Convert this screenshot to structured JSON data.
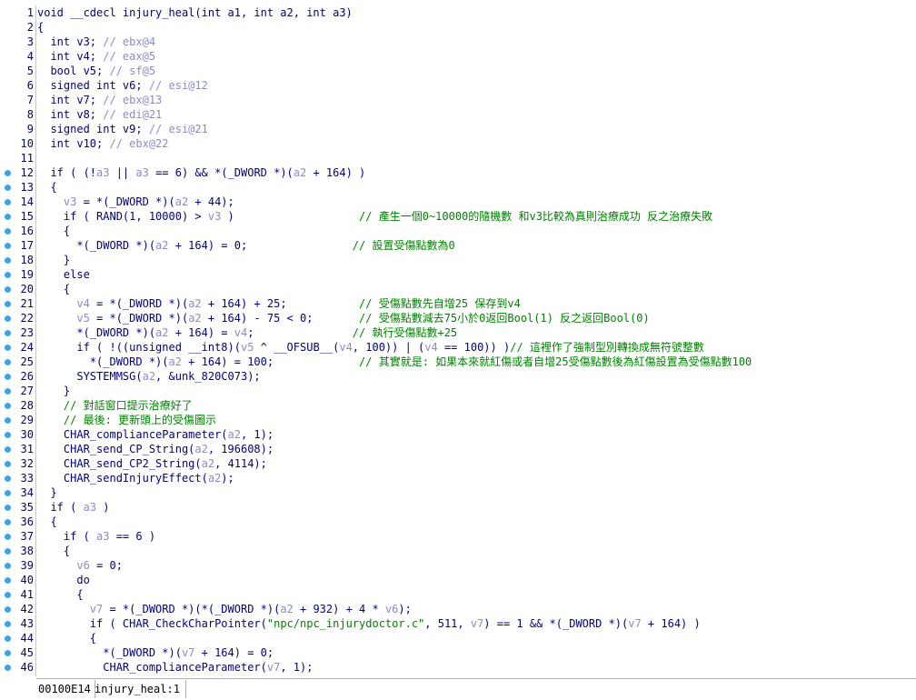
{
  "editor": {
    "lines": [
      {
        "n": "1",
        "bp": false,
        "segs": [
          [
            "t",
            "void __cdecl injury_heal(int a1, int a2, int a3)"
          ]
        ]
      },
      {
        "n": "2",
        "bp": false,
        "segs": [
          [
            "t",
            "{"
          ]
        ]
      },
      {
        "n": "3",
        "bp": false,
        "segs": [
          [
            "t",
            "  int v3; "
          ],
          [
            "v",
            "// ebx@4"
          ]
        ]
      },
      {
        "n": "4",
        "bp": false,
        "segs": [
          [
            "t",
            "  int v4; "
          ],
          [
            "v",
            "// eax@5"
          ]
        ]
      },
      {
        "n": "5",
        "bp": false,
        "segs": [
          [
            "t",
            "  bool v5; "
          ],
          [
            "v",
            "// sf@5"
          ]
        ]
      },
      {
        "n": "6",
        "bp": false,
        "segs": [
          [
            "t",
            "  signed int v6; "
          ],
          [
            "v",
            "// esi@12"
          ]
        ]
      },
      {
        "n": "7",
        "bp": false,
        "segs": [
          [
            "t",
            "  int v7; "
          ],
          [
            "v",
            "// ebx@13"
          ]
        ]
      },
      {
        "n": "8",
        "bp": false,
        "segs": [
          [
            "t",
            "  int v8; "
          ],
          [
            "v",
            "// edi@21"
          ]
        ]
      },
      {
        "n": "9",
        "bp": false,
        "segs": [
          [
            "t",
            "  signed int v9; "
          ],
          [
            "v",
            "// esi@21"
          ]
        ]
      },
      {
        "n": "10",
        "bp": false,
        "segs": [
          [
            "t",
            "  int v10; "
          ],
          [
            "v",
            "// ebx@22"
          ]
        ]
      },
      {
        "n": "11",
        "bp": false,
        "segs": [
          [
            "t",
            ""
          ]
        ]
      },
      {
        "n": "12",
        "bp": true,
        "segs": [
          [
            "t",
            "  if ( (!"
          ],
          [
            "v",
            "a3"
          ],
          [
            "t",
            " || "
          ],
          [
            "v",
            "a3"
          ],
          [
            "t",
            " == 6) && *(_DWORD *)("
          ],
          [
            "v",
            "a2"
          ],
          [
            "t",
            " + 164) )"
          ]
        ]
      },
      {
        "n": "13",
        "bp": true,
        "segs": [
          [
            "t",
            "  {"
          ]
        ]
      },
      {
        "n": "14",
        "bp": true,
        "segs": [
          [
            "t",
            "    "
          ],
          [
            "v",
            "v3"
          ],
          [
            "t",
            " = *(_DWORD *)("
          ],
          [
            "v",
            "a2"
          ],
          [
            "t",
            " + 44);"
          ]
        ]
      },
      {
        "n": "15",
        "bp": true,
        "segs": [
          [
            "t",
            "    if ( RAND(1, 10000) > "
          ],
          [
            "v",
            "v3"
          ],
          [
            "t",
            " )                   "
          ],
          [
            "c",
            "// 產生一個0~10000的隨機數 和v3比較為真則治療成功 反之治療失敗"
          ]
        ]
      },
      {
        "n": "16",
        "bp": true,
        "segs": [
          [
            "t",
            "    {"
          ]
        ]
      },
      {
        "n": "17",
        "bp": true,
        "segs": [
          [
            "t",
            "      *(_DWORD *)("
          ],
          [
            "v",
            "a2"
          ],
          [
            "t",
            " + 164) = 0;                "
          ],
          [
            "c",
            "// 設置受傷點數為0"
          ]
        ]
      },
      {
        "n": "18",
        "bp": true,
        "segs": [
          [
            "t",
            "    }"
          ]
        ]
      },
      {
        "n": "19",
        "bp": true,
        "segs": [
          [
            "t",
            "    else"
          ]
        ]
      },
      {
        "n": "20",
        "bp": true,
        "segs": [
          [
            "t",
            "    {"
          ]
        ]
      },
      {
        "n": "21",
        "bp": true,
        "segs": [
          [
            "t",
            "      "
          ],
          [
            "v",
            "v4"
          ],
          [
            "t",
            " = *(_DWORD *)("
          ],
          [
            "v",
            "a2"
          ],
          [
            "t",
            " + 164) + 25;           "
          ],
          [
            "c",
            "// 受傷點數先自增25 保存到v4"
          ]
        ]
      },
      {
        "n": "22",
        "bp": true,
        "segs": [
          [
            "t",
            "      "
          ],
          [
            "v",
            "v5"
          ],
          [
            "t",
            " = *(_DWORD *)("
          ],
          [
            "v",
            "a2"
          ],
          [
            "t",
            " + 164) - 75 < 0;       "
          ],
          [
            "c",
            "// 受傷點數減去75小於0返回Bool(1) 反之返回Bool(0)"
          ]
        ]
      },
      {
        "n": "23",
        "bp": true,
        "segs": [
          [
            "t",
            "      *(_DWORD *)("
          ],
          [
            "v",
            "a2"
          ],
          [
            "t",
            " + 164) = "
          ],
          [
            "v",
            "v4"
          ],
          [
            "t",
            ";               "
          ],
          [
            "c",
            "// 執行受傷點數+25"
          ]
        ]
      },
      {
        "n": "24",
        "bp": true,
        "segs": [
          [
            "t",
            "      if ( !((unsigned __int8)("
          ],
          [
            "v",
            "v5"
          ],
          [
            "t",
            " ^ __OFSUB__("
          ],
          [
            "v",
            "v4"
          ],
          [
            "t",
            ", 100)) | ("
          ],
          [
            "v",
            "v4"
          ],
          [
            "t",
            " == 100)) )"
          ],
          [
            "c",
            "// 這裡作了強制型別轉換成無符號整數"
          ]
        ]
      },
      {
        "n": "25",
        "bp": true,
        "segs": [
          [
            "t",
            "        *(_DWORD *)("
          ],
          [
            "v",
            "a2"
          ],
          [
            "t",
            " + 164) = 100;             "
          ],
          [
            "c",
            "// 其實就是: 如果本來就紅傷或者自增25受傷點數後為紅傷設置為受傷點數100"
          ]
        ]
      },
      {
        "n": "26",
        "bp": true,
        "segs": [
          [
            "t",
            "      SYSTEMMSG("
          ],
          [
            "v",
            "a2"
          ],
          [
            "t",
            ", &unk_820C073);"
          ]
        ]
      },
      {
        "n": "27",
        "bp": true,
        "segs": [
          [
            "t",
            "    }"
          ]
        ]
      },
      {
        "n": "28",
        "bp": true,
        "segs": [
          [
            "t",
            "    "
          ],
          [
            "c",
            "// 對話窗口提示治療好了"
          ]
        ]
      },
      {
        "n": "29",
        "bp": true,
        "segs": [
          [
            "t",
            "    "
          ],
          [
            "c",
            "// 最後: 更新頭上的受傷圖示"
          ]
        ]
      },
      {
        "n": "30",
        "bp": true,
        "segs": [
          [
            "t",
            "    CHAR_complianceParameter("
          ],
          [
            "v",
            "a2"
          ],
          [
            "t",
            ", 1);"
          ]
        ]
      },
      {
        "n": "31",
        "bp": true,
        "segs": [
          [
            "t",
            "    CHAR_send_CP_String("
          ],
          [
            "v",
            "a2"
          ],
          [
            "t",
            ", 196608);"
          ]
        ]
      },
      {
        "n": "32",
        "bp": true,
        "segs": [
          [
            "t",
            "    CHAR_send_CP2_String("
          ],
          [
            "v",
            "a2"
          ],
          [
            "t",
            ", 4114);"
          ]
        ]
      },
      {
        "n": "33",
        "bp": true,
        "segs": [
          [
            "t",
            "    CHAR_sendInjuryEffect("
          ],
          [
            "v",
            "a2"
          ],
          [
            "t",
            ");"
          ]
        ]
      },
      {
        "n": "34",
        "bp": true,
        "segs": [
          [
            "t",
            "  }"
          ]
        ]
      },
      {
        "n": "35",
        "bp": true,
        "segs": [
          [
            "t",
            "  if ( "
          ],
          [
            "v",
            "a3"
          ],
          [
            "t",
            " )"
          ]
        ]
      },
      {
        "n": "36",
        "bp": true,
        "segs": [
          [
            "t",
            "  {"
          ]
        ]
      },
      {
        "n": "37",
        "bp": true,
        "segs": [
          [
            "t",
            "    if ( "
          ],
          [
            "v",
            "a3"
          ],
          [
            "t",
            " == 6 )"
          ]
        ]
      },
      {
        "n": "38",
        "bp": true,
        "segs": [
          [
            "t",
            "    {"
          ]
        ]
      },
      {
        "n": "39",
        "bp": true,
        "segs": [
          [
            "t",
            "      "
          ],
          [
            "v",
            "v6"
          ],
          [
            "t",
            " = 0;"
          ]
        ]
      },
      {
        "n": "40",
        "bp": true,
        "segs": [
          [
            "t",
            "      do"
          ]
        ]
      },
      {
        "n": "41",
        "bp": true,
        "segs": [
          [
            "t",
            "      {"
          ]
        ]
      },
      {
        "n": "42",
        "bp": true,
        "segs": [
          [
            "t",
            "        "
          ],
          [
            "v",
            "v7"
          ],
          [
            "t",
            " = *(_DWORD *)(*(_DWORD *)("
          ],
          [
            "v",
            "a2"
          ],
          [
            "t",
            " + 932) + 4 * "
          ],
          [
            "v",
            "v6"
          ],
          [
            "t",
            ");"
          ]
        ]
      },
      {
        "n": "43",
        "bp": true,
        "segs": [
          [
            "t",
            "        if ( CHAR_CheckCharPointer("
          ],
          [
            "s",
            "\"npc/npc_injurydoctor.c\""
          ],
          [
            "t",
            ", 511, "
          ],
          [
            "v",
            "v7"
          ],
          [
            "t",
            ") == 1 && *(_DWORD *)("
          ],
          [
            "v",
            "v7"
          ],
          [
            "t",
            " + 164) )"
          ]
        ]
      },
      {
        "n": "44",
        "bp": true,
        "segs": [
          [
            "t",
            "        {"
          ]
        ]
      },
      {
        "n": "45",
        "bp": true,
        "segs": [
          [
            "t",
            "          *(_DWORD *)("
          ],
          [
            "v",
            "v7"
          ],
          [
            "t",
            " + 164) = 0;"
          ]
        ]
      },
      {
        "n": "46",
        "bp": true,
        "segs": [
          [
            "t",
            "          CHAR_complianceParameter("
          ],
          [
            "v",
            "v7"
          ],
          [
            "t",
            ", 1);"
          ]
        ]
      }
    ]
  },
  "statusbar": {
    "address": "00100E14",
    "function": "injury_heal:1"
  }
}
